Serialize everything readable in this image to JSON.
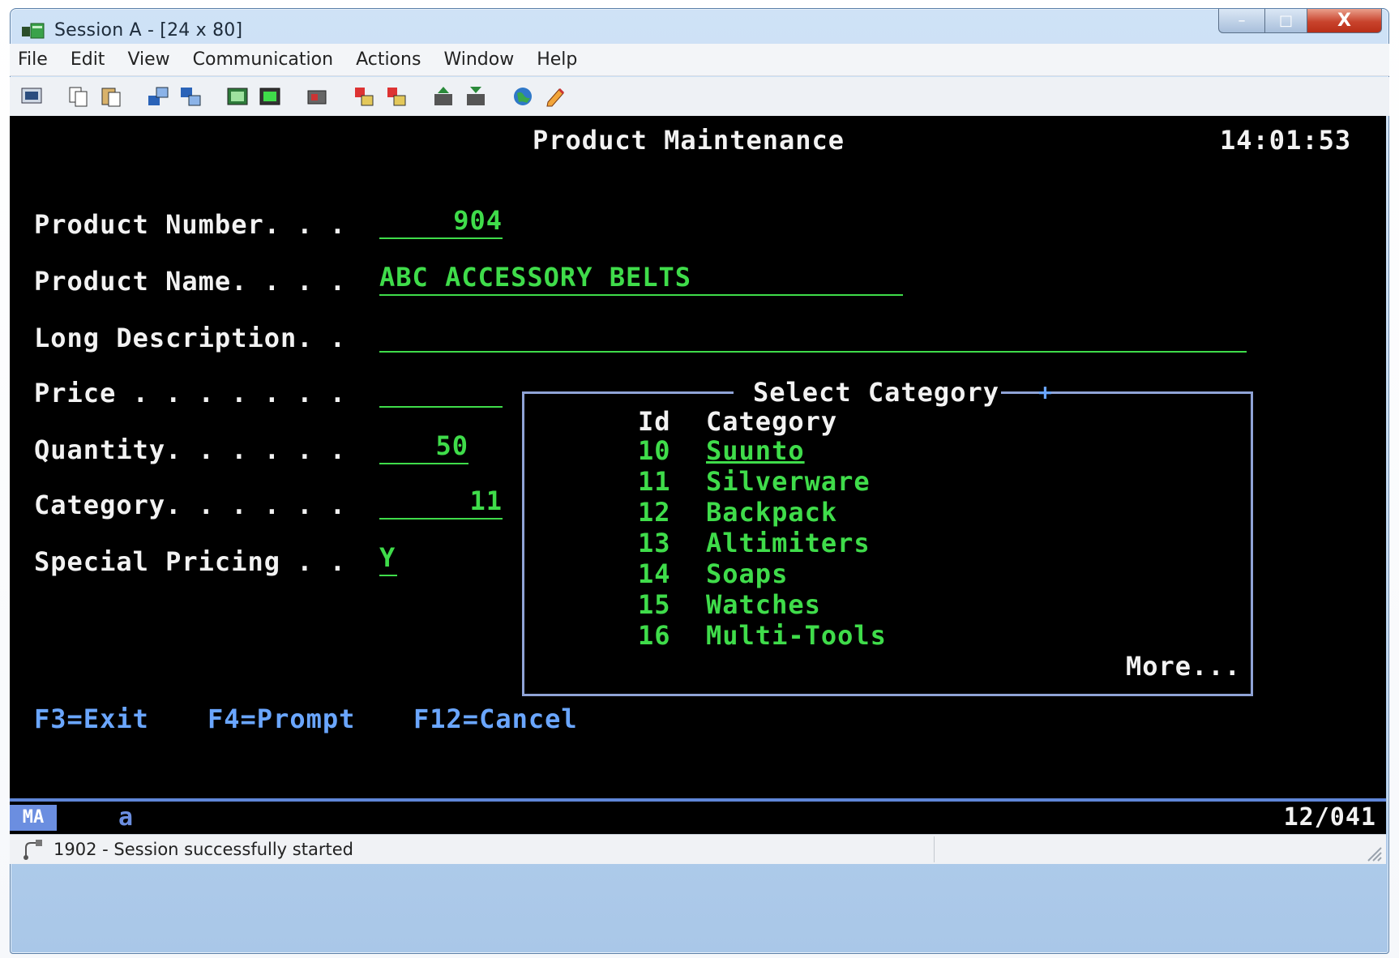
{
  "window": {
    "title": "Session A - [24 x 80]",
    "controls": {
      "minimize": "–",
      "maximize": "□",
      "close": "X"
    }
  },
  "menu": [
    "File",
    "Edit",
    "View",
    "Communication",
    "Actions",
    "Window",
    "Help"
  ],
  "screen": {
    "heading": "Product Maintenance",
    "time": "14:01:53",
    "fields": [
      {
        "label": "Product Number. . .",
        "value": "904"
      },
      {
        "label": "Product Name. . . .",
        "value": "ABC ACCESSORY BELTS"
      },
      {
        "label": "Long Description. .",
        "value": ""
      },
      {
        "label": "Price . . . . . . .",
        "value": ""
      },
      {
        "label": "Quantity. . . . . .",
        "value": "50"
      },
      {
        "label": "Category. . . . . .",
        "value": "11"
      },
      {
        "label": "Special Pricing . .",
        "value": "Y"
      }
    ],
    "function_keys": [
      "F3=Exit",
      "F4=Prompt",
      "F12=Cancel"
    ]
  },
  "popup": {
    "title": "Select Category",
    "col_id": "Id",
    "col_category": "Category",
    "rows": [
      {
        "id": "10",
        "name": "Suunto"
      },
      {
        "id": "11",
        "name": "Silverware"
      },
      {
        "id": "12",
        "name": "Backpack"
      },
      {
        "id": "13",
        "name": "Altimiters"
      },
      {
        "id": "14",
        "name": "Soaps"
      },
      {
        "id": "15",
        "name": "Watches"
      },
      {
        "id": "16",
        "name": "Multi-Tools"
      }
    ],
    "more": "More..."
  },
  "oia": {
    "indicator": "MA",
    "input": "a",
    "cursor_pos": "12/041"
  },
  "statusbar": {
    "text": "1902 - Session successfully started"
  },
  "colors": {
    "terminal_bg": "#000000",
    "field_green": "#3fdc4a",
    "label_white": "#f2f2f2",
    "fkey_blue": "#6aa6ff",
    "popup_border": "#8fa3d6"
  }
}
